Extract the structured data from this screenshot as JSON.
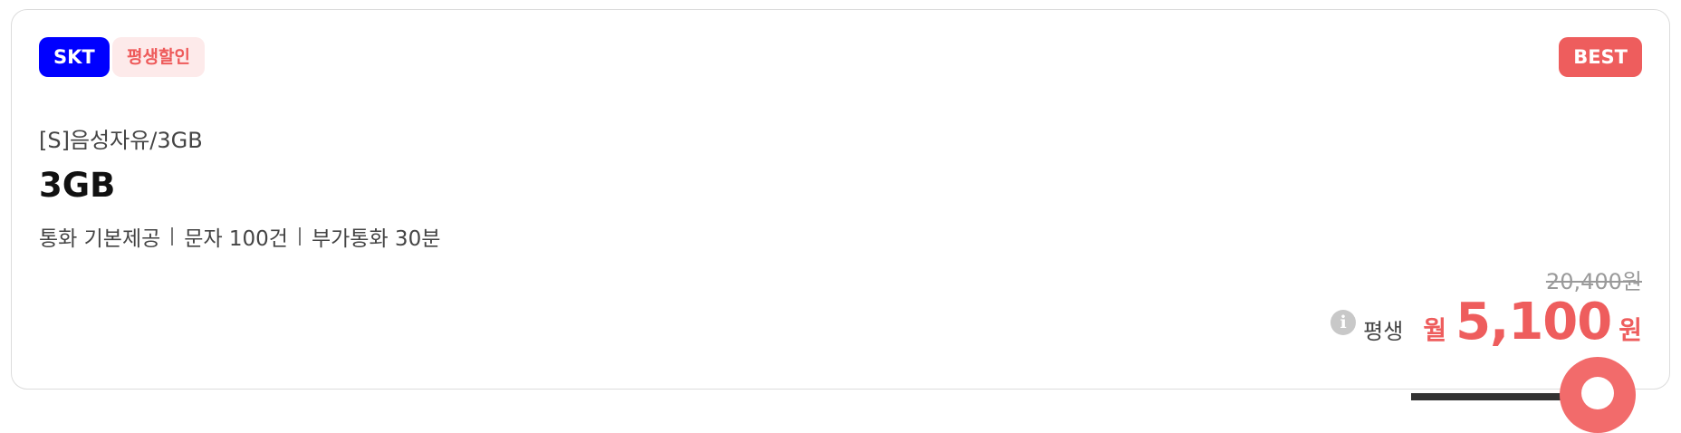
{
  "card": {
    "carrier_badge": "SKT",
    "promo_badge": "평생할인",
    "best_badge": "BEST",
    "plan_name": "[S]음성자유/3GB",
    "data_amount": "3GB",
    "features": {
      "calls": "통화 기본제공",
      "sms": "문자 100건",
      "extra_calls": "부가통화 30분"
    },
    "price": {
      "original": "20,400원",
      "duration_label": "평생",
      "month_label": "월",
      "amount": "5,100",
      "currency": "원"
    }
  },
  "icons": {
    "info": "info-icon",
    "chat": "chat-icon"
  },
  "colors": {
    "carrier_blue": "#0000ff",
    "accent_red": "#ee5d5d",
    "promo_bg": "#fdeaea"
  }
}
